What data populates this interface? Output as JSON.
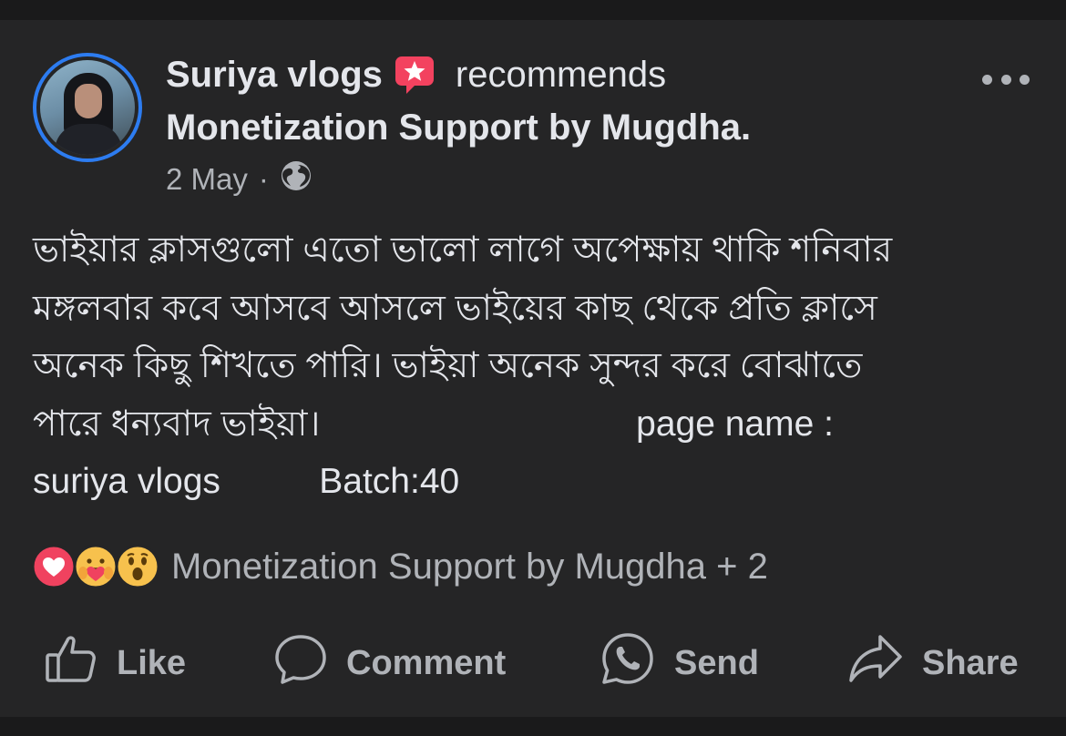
{
  "post": {
    "author": "Suriya vlogs",
    "recommends_text": "recommends",
    "page_title": "Monetization Support by Mugdha.",
    "date": "2 May",
    "separator": "·",
    "privacy_icon": "globe-icon",
    "body_lines": [
      "ভাইয়ার ক্লাসগুলো এতো ভালো লাগে অপেক্ষায় থাকি শনিবার",
      "মঙ্গলবার কবে আসবে আসলে ভাইয়ের কাছ থেকে প্রতি ক্লাসে",
      "অনেক কিছু শিখতে পারি। ভাইয়া অনেক সুন্দর করে বোঝাতে",
      "পারে ধন্যবাদ ভাইয়া।                                page name :",
      "suriya vlogs          Batch:40"
    ]
  },
  "reactions": {
    "icons": [
      "love-reaction-icon",
      "care-reaction-icon",
      "wow-reaction-icon"
    ],
    "summary": "Monetization Support by Mugdha + 2"
  },
  "actions": {
    "like": "Like",
    "comment": "Comment",
    "send": "Send",
    "share": "Share"
  },
  "colors": {
    "background": "#252526",
    "avatar_ring": "#2d7cf0",
    "recommend_badge": "#f3425f",
    "secondary_text": "#b0b3b8",
    "primary_text": "#e4e6eb"
  }
}
